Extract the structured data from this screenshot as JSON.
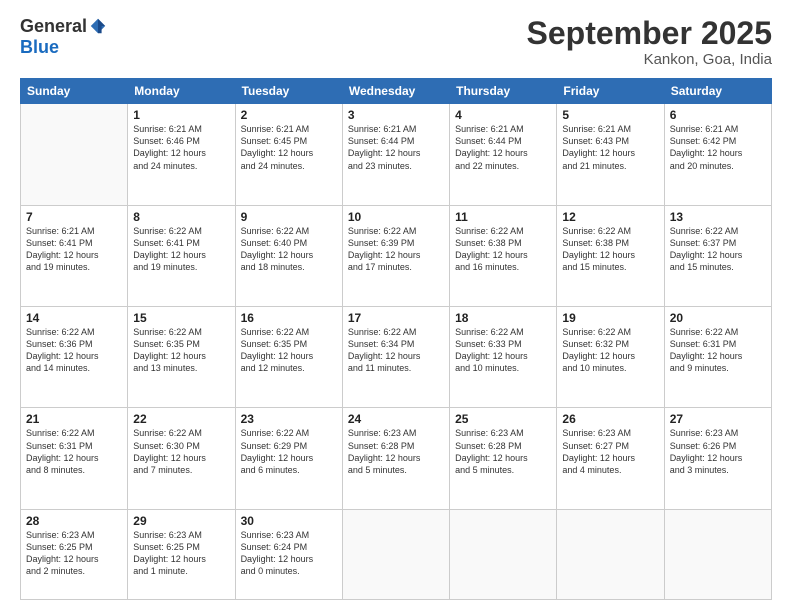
{
  "header": {
    "logo_general": "General",
    "logo_blue": "Blue",
    "month_title": "September 2025",
    "location": "Kankon, Goa, India"
  },
  "days_of_week": [
    "Sunday",
    "Monday",
    "Tuesday",
    "Wednesday",
    "Thursday",
    "Friday",
    "Saturday"
  ],
  "weeks": [
    [
      {
        "day": "",
        "info": ""
      },
      {
        "day": "1",
        "info": "Sunrise: 6:21 AM\nSunset: 6:46 PM\nDaylight: 12 hours\nand 24 minutes."
      },
      {
        "day": "2",
        "info": "Sunrise: 6:21 AM\nSunset: 6:45 PM\nDaylight: 12 hours\nand 24 minutes."
      },
      {
        "day": "3",
        "info": "Sunrise: 6:21 AM\nSunset: 6:44 PM\nDaylight: 12 hours\nand 23 minutes."
      },
      {
        "day": "4",
        "info": "Sunrise: 6:21 AM\nSunset: 6:44 PM\nDaylight: 12 hours\nand 22 minutes."
      },
      {
        "day": "5",
        "info": "Sunrise: 6:21 AM\nSunset: 6:43 PM\nDaylight: 12 hours\nand 21 minutes."
      },
      {
        "day": "6",
        "info": "Sunrise: 6:21 AM\nSunset: 6:42 PM\nDaylight: 12 hours\nand 20 minutes."
      }
    ],
    [
      {
        "day": "7",
        "info": "Sunrise: 6:21 AM\nSunset: 6:41 PM\nDaylight: 12 hours\nand 19 minutes."
      },
      {
        "day": "8",
        "info": "Sunrise: 6:22 AM\nSunset: 6:41 PM\nDaylight: 12 hours\nand 19 minutes."
      },
      {
        "day": "9",
        "info": "Sunrise: 6:22 AM\nSunset: 6:40 PM\nDaylight: 12 hours\nand 18 minutes."
      },
      {
        "day": "10",
        "info": "Sunrise: 6:22 AM\nSunset: 6:39 PM\nDaylight: 12 hours\nand 17 minutes."
      },
      {
        "day": "11",
        "info": "Sunrise: 6:22 AM\nSunset: 6:38 PM\nDaylight: 12 hours\nand 16 minutes."
      },
      {
        "day": "12",
        "info": "Sunrise: 6:22 AM\nSunset: 6:38 PM\nDaylight: 12 hours\nand 15 minutes."
      },
      {
        "day": "13",
        "info": "Sunrise: 6:22 AM\nSunset: 6:37 PM\nDaylight: 12 hours\nand 15 minutes."
      }
    ],
    [
      {
        "day": "14",
        "info": "Sunrise: 6:22 AM\nSunset: 6:36 PM\nDaylight: 12 hours\nand 14 minutes."
      },
      {
        "day": "15",
        "info": "Sunrise: 6:22 AM\nSunset: 6:35 PM\nDaylight: 12 hours\nand 13 minutes."
      },
      {
        "day": "16",
        "info": "Sunrise: 6:22 AM\nSunset: 6:35 PM\nDaylight: 12 hours\nand 12 minutes."
      },
      {
        "day": "17",
        "info": "Sunrise: 6:22 AM\nSunset: 6:34 PM\nDaylight: 12 hours\nand 11 minutes."
      },
      {
        "day": "18",
        "info": "Sunrise: 6:22 AM\nSunset: 6:33 PM\nDaylight: 12 hours\nand 10 minutes."
      },
      {
        "day": "19",
        "info": "Sunrise: 6:22 AM\nSunset: 6:32 PM\nDaylight: 12 hours\nand 10 minutes."
      },
      {
        "day": "20",
        "info": "Sunrise: 6:22 AM\nSunset: 6:31 PM\nDaylight: 12 hours\nand 9 minutes."
      }
    ],
    [
      {
        "day": "21",
        "info": "Sunrise: 6:22 AM\nSunset: 6:31 PM\nDaylight: 12 hours\nand 8 minutes."
      },
      {
        "day": "22",
        "info": "Sunrise: 6:22 AM\nSunset: 6:30 PM\nDaylight: 12 hours\nand 7 minutes."
      },
      {
        "day": "23",
        "info": "Sunrise: 6:22 AM\nSunset: 6:29 PM\nDaylight: 12 hours\nand 6 minutes."
      },
      {
        "day": "24",
        "info": "Sunrise: 6:23 AM\nSunset: 6:28 PM\nDaylight: 12 hours\nand 5 minutes."
      },
      {
        "day": "25",
        "info": "Sunrise: 6:23 AM\nSunset: 6:28 PM\nDaylight: 12 hours\nand 5 minutes."
      },
      {
        "day": "26",
        "info": "Sunrise: 6:23 AM\nSunset: 6:27 PM\nDaylight: 12 hours\nand 4 minutes."
      },
      {
        "day": "27",
        "info": "Sunrise: 6:23 AM\nSunset: 6:26 PM\nDaylight: 12 hours\nand 3 minutes."
      }
    ],
    [
      {
        "day": "28",
        "info": "Sunrise: 6:23 AM\nSunset: 6:25 PM\nDaylight: 12 hours\nand 2 minutes."
      },
      {
        "day": "29",
        "info": "Sunrise: 6:23 AM\nSunset: 6:25 PM\nDaylight: 12 hours\nand 1 minute."
      },
      {
        "day": "30",
        "info": "Sunrise: 6:23 AM\nSunset: 6:24 PM\nDaylight: 12 hours\nand 0 minutes."
      },
      {
        "day": "",
        "info": ""
      },
      {
        "day": "",
        "info": ""
      },
      {
        "day": "",
        "info": ""
      },
      {
        "day": "",
        "info": ""
      }
    ]
  ]
}
